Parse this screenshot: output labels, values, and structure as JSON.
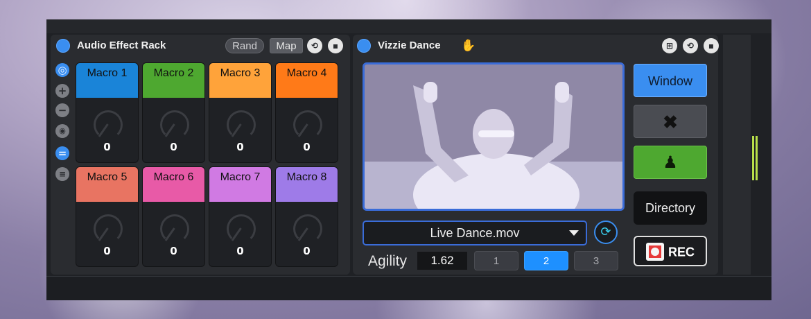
{
  "rack": {
    "title": "Audio Effect Rack",
    "rand_label": "Rand",
    "map_label": "Map",
    "macros": [
      {
        "label": "Macro 1",
        "value": "0",
        "color": "#1a84d8"
      },
      {
        "label": "Macro 2",
        "value": "0",
        "color": "#4ea830"
      },
      {
        "label": "Macro 3",
        "value": "0",
        "color": "#ffa33a"
      },
      {
        "label": "Macro 4",
        "value": "0",
        "color": "#ff7a18"
      },
      {
        "label": "Macro 5",
        "value": "0",
        "color": "#e87462"
      },
      {
        "label": "Macro 6",
        "value": "0",
        "color": "#e85aa7"
      },
      {
        "label": "Macro 7",
        "value": "0",
        "color": "#d07ae3"
      },
      {
        "label": "Macro 8",
        "value": "0",
        "color": "#9e7be8"
      }
    ]
  },
  "vizzie": {
    "title": "Vizzie Dance",
    "window_label": "Window",
    "directory_label": "Directory",
    "rec_label": "REC",
    "file_selected": "Live Dance.mov",
    "agility_label": "Agility",
    "agility_value": "1.62",
    "segments": [
      "1",
      "2",
      "3"
    ],
    "active_segment": "2"
  },
  "colors": {
    "accent_blue": "#3a8ef0",
    "window_button": "#3a8ef0",
    "posture_button": "#4ea830",
    "meter": "#b8e04a"
  }
}
